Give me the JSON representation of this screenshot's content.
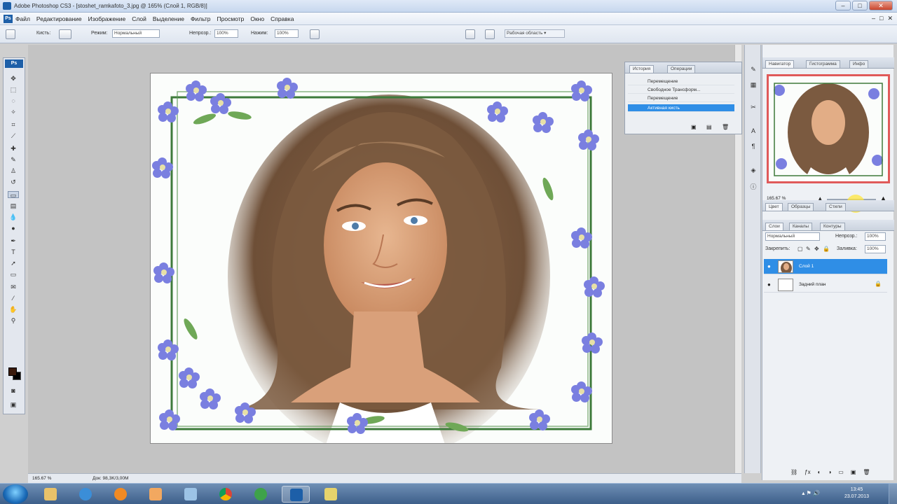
{
  "window": {
    "title": "Adobe Photoshop CS3 - [stoshet_ramkafoto_3.jpg @ 165% (Слой 1, RGB/8)]",
    "controls": {
      "minimize": "–",
      "maximize": "□",
      "close": "✕"
    }
  },
  "menu": {
    "items": [
      "Файл",
      "Редактирование",
      "Изображение",
      "Слой",
      "Выделение",
      "Фильтр",
      "Просмотр",
      "Окно",
      "Справка"
    ],
    "doc_controls": [
      "–",
      "□",
      "✕"
    ]
  },
  "options": {
    "mode_label": "Режим:",
    "mode_value": "Нормальный",
    "opacity_label": "Непрозр.:",
    "opacity_value": "100%",
    "flow_label": "Нажим:",
    "flow_value": "100%",
    "brush_label": "Кисть:",
    "workspace_label": "Рабочая область ▾"
  },
  "toolbox": {
    "header": "Ps",
    "tools": [
      "move-icon",
      "marquee-icon",
      "lasso-icon",
      "magic-wand-icon",
      "crop-icon",
      "slice-icon",
      "healing-icon",
      "brush-icon",
      "stamp-icon",
      "history-brush-icon",
      "eraser-icon",
      "gradient-icon",
      "blur-icon",
      "dodge-icon",
      "pen-icon",
      "type-icon",
      "path-select-icon",
      "shape-icon",
      "notes-icon",
      "eyedropper-icon",
      "hand-icon",
      "zoom-icon"
    ],
    "foreground_color": "#3a1a0c",
    "background_color": "#000000"
  },
  "history": {
    "tabs": [
      "История",
      "Операции"
    ],
    "rows": [
      "Перемещение",
      "Свободное Трансформ...",
      "Перемещение",
      "Активная кисть"
    ],
    "selected_index": 3
  },
  "navigator": {
    "tabs": [
      "Навигатор",
      "Гистограмма",
      "Инфо"
    ],
    "zoom_value": "165.67 %"
  },
  "color": {
    "tabs": [
      "Цвет",
      "Образцы",
      "Стили"
    ]
  },
  "layers": {
    "tabs": [
      "Слои",
      "Каналы",
      "Контуры"
    ],
    "blend_mode": "Нормальный",
    "opacity_label": "Непрозр.:",
    "opacity_value": "100%",
    "lock_label": "Закрепить:",
    "fill_label": "Заливка:",
    "fill_value": "100%",
    "items": [
      {
        "name": "Слой 1",
        "selected": true
      },
      {
        "name": "Задний план",
        "selected": false
      }
    ]
  },
  "doc_status": {
    "zoom": "165.67 %",
    "info": "Док: 98,3K/3,00M"
  },
  "taskbar": {
    "clock_time": "13:45",
    "clock_date": "23.07.2013",
    "apps": [
      "explorer-icon",
      "ie-icon",
      "media-player-icon",
      "paint-icon",
      "network-icon",
      "chrome-icon",
      "utorrent-icon",
      "photoshop-icon",
      "tools-icon"
    ]
  }
}
